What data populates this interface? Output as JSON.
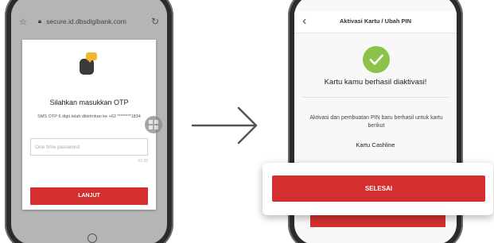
{
  "colors": {
    "brand_red": "#d32f2f",
    "success_green": "#8bc34a",
    "otp_icon_yellow": "#f2b632"
  },
  "left_phone": {
    "browser": {
      "favorite_icon": "star-icon",
      "lock_icon": "lock-icon",
      "url": "secure.id.dbsdigibank.com",
      "reload_icon": "reload-icon"
    },
    "otp_card": {
      "icon": "phone-otp-icon",
      "title": "Silahkan masukkan OTP",
      "description": "SMS OTP 6 digit telah dikirimkan ke +62 ********1834",
      "input_placeholder": "One time password",
      "input_value": "",
      "timer": "01:58",
      "submit_label": "LANJUT"
    }
  },
  "arrow_icon": "arrow-right-icon",
  "right_phone": {
    "header": {
      "back_icon": "chevron-left-icon",
      "title": "Aktivasi Kartu / Ubah PIN"
    },
    "success_icon": "check-icon",
    "success_message": "Kartu kamu berhasil diaktivasi!",
    "info_text": "Aktivasi dan pembuatan PIN baru berhasil untuk kartu berikut",
    "card_name": "Kartu Cashline",
    "done_label": "SELESAI"
  }
}
